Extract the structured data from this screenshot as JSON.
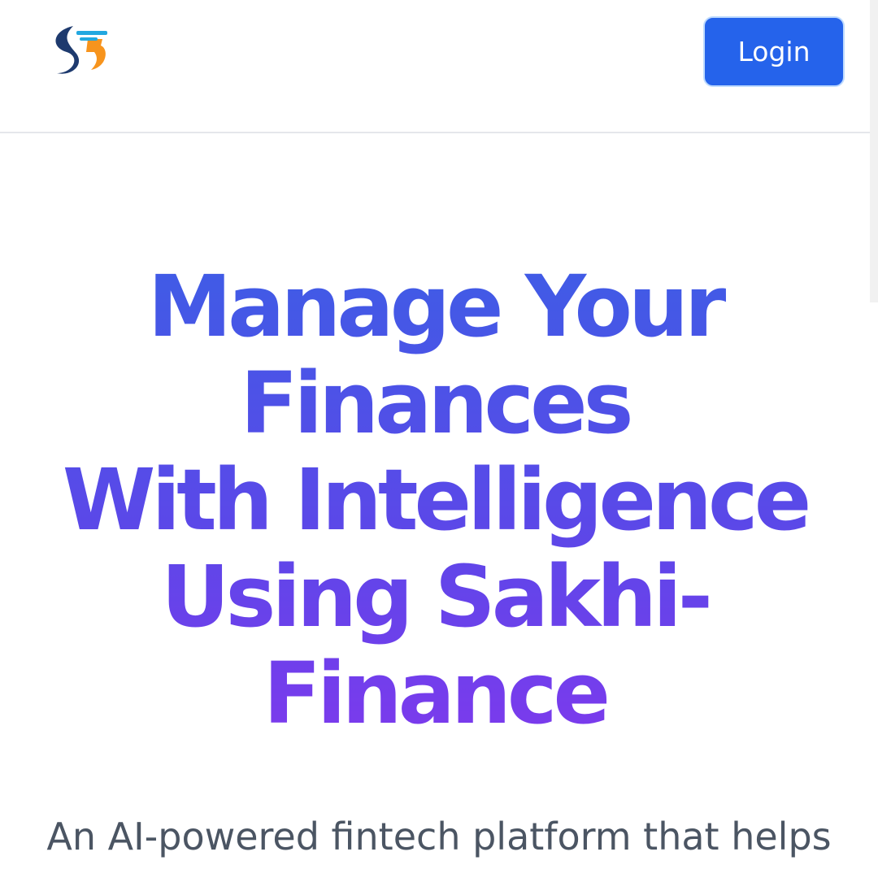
{
  "header": {
    "logo_icon": "sakhi-finance-logo",
    "login_label": "Login"
  },
  "hero": {
    "title_lines": [
      "Manage Your",
      "Finances",
      "With Intelligence",
      "Using Sakhi-",
      "Finance"
    ],
    "subtitle": "An AI-powered fintech platform that helps"
  },
  "colors": {
    "accent": "#2563eb",
    "gradient_start": "#3f5ce6",
    "gradient_end": "#7c3aed",
    "logo_navy": "#1e3a6e",
    "logo_cyan": "#22a8e0",
    "logo_orange": "#f7941d"
  }
}
